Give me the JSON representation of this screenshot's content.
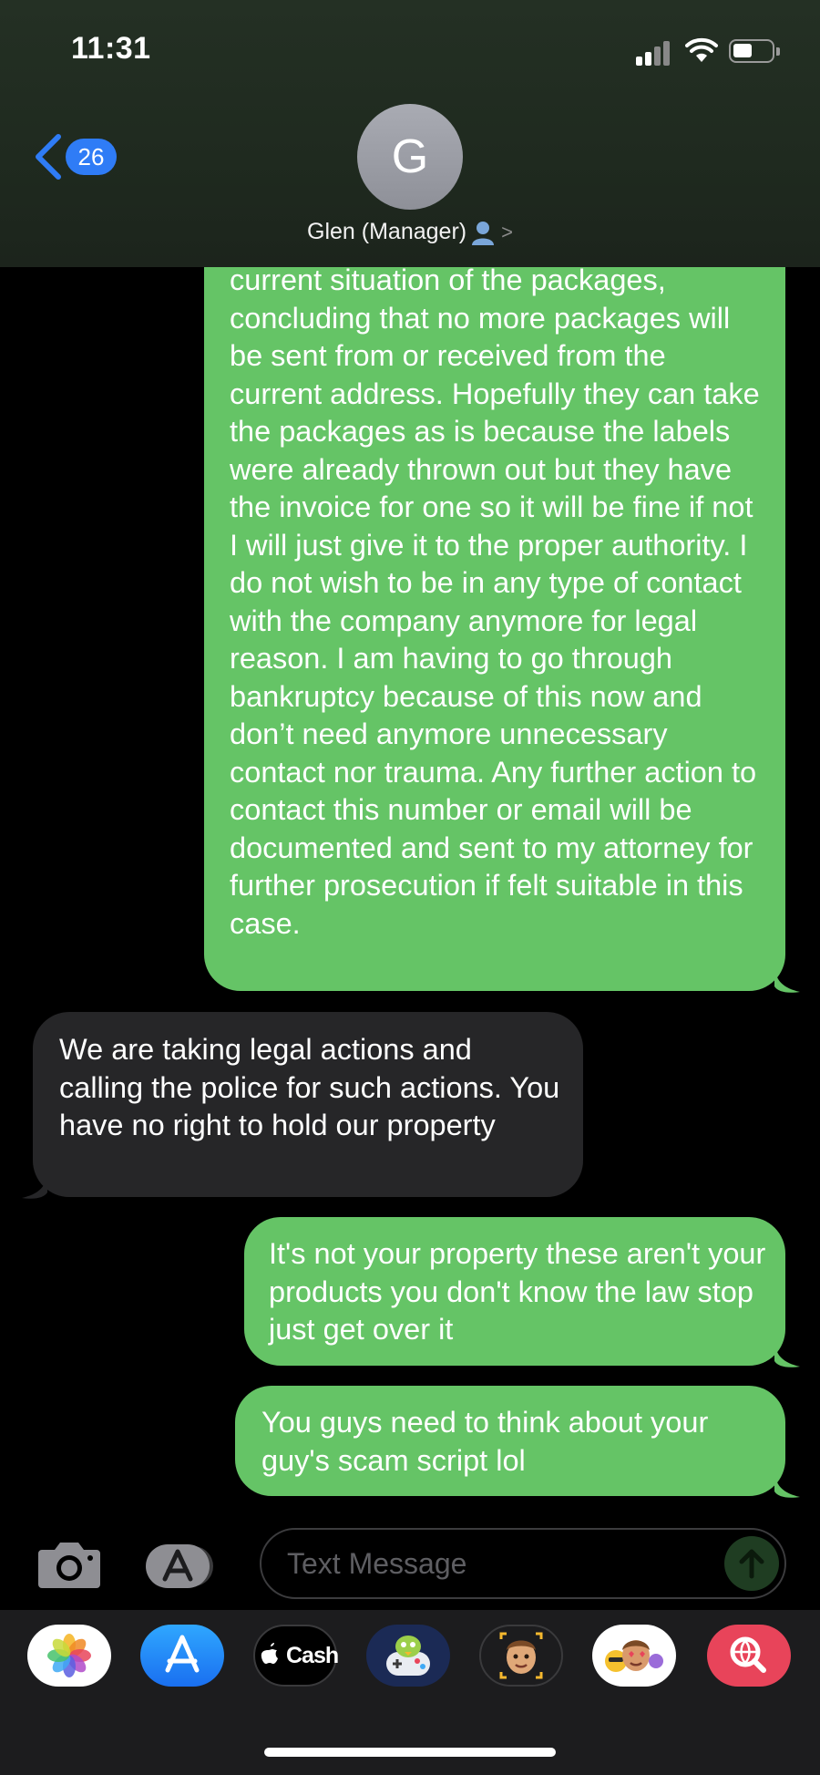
{
  "status_bar": {
    "time": "11:31"
  },
  "header": {
    "back_count": "26",
    "avatar_initial": "G",
    "contact_name": "Glen  (Manager)",
    "chevron": ">"
  },
  "messages": [
    {
      "direction": "sent",
      "text": "current situation of the packages, concluding that no more packages will be sent from or received from the current address. Hopefully they can take the packages as is because the labels were already thrown out but they have the invoice for one so it will be fine if not I will just give it to the proper authority. I do not wish to be in any type of contact with the company anymore for legal reason. I am having to go through bankruptcy because of this now and don’t need anymore unnecessary contact nor trauma. Any further action to contact this number or email will be documented and sent to my attorney for further prosecution if felt suitable in this case."
    },
    {
      "direction": "received",
      "text": "We are taking legal actions and calling the police for such actions. You have no right to hold our property"
    },
    {
      "direction": "sent",
      "text": "It's not your property these aren't your products you don't know the law stop just get over it"
    },
    {
      "direction": "sent",
      "text": "You guys need to think about your guy's scam script lol"
    }
  ],
  "compose": {
    "placeholder": "Text Message"
  },
  "app_drawer": [
    {
      "name": "photos-app-icon"
    },
    {
      "name": "app-store-icon"
    },
    {
      "name": "apple-cash-icon",
      "label": "Cash"
    },
    {
      "name": "game-pigeon-icon"
    },
    {
      "name": "memoji-icon"
    },
    {
      "name": "memoji-stickers-icon"
    },
    {
      "name": "images-search-icon"
    }
  ],
  "colors": {
    "sent_bubble": "#65c466",
    "received_bubble": "#262628",
    "badge": "#2f7cf6",
    "images_app": "#e8445a"
  }
}
